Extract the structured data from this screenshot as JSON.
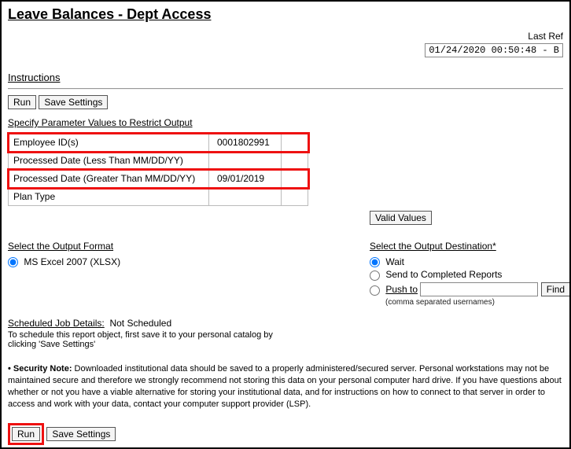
{
  "title": "Leave Balances - Dept Access",
  "lastRefLabel": "Last Ref",
  "refreshStamp": "01/24/2020 00:50:48 - B",
  "instructions": "Instructions",
  "buttons": {
    "run": "Run",
    "saveSettings": "Save Settings",
    "validValues": "Valid Values",
    "find": "Find"
  },
  "paramHeader": "Specify Parameter Values to Restrict Output",
  "params": {
    "employeeId": {
      "label": "Employee ID(s)",
      "value": "0001802991"
    },
    "processedLess": {
      "label": "Processed Date (Less Than MM/DD/YY)",
      "value": ""
    },
    "processedGreater": {
      "label": "Processed Date (Greater Than MM/DD/YY)",
      "value": "09/01/2019"
    },
    "planType": {
      "label": "Plan Type",
      "value": ""
    }
  },
  "outputFormat": {
    "header": "Select the Output Format",
    "option": "MS Excel 2007 (XLSX)"
  },
  "outputDest": {
    "header": "Select the Output Destination*",
    "wait": "Wait",
    "completed": "Send to Completed Reports",
    "pushto": "Push to",
    "note": "(comma separated usernames)"
  },
  "schedule": {
    "header": "Scheduled Job Details:",
    "status": "Not Scheduled",
    "desc": "To schedule this report object, first save it to your personal catalog by clicking 'Save Settings'"
  },
  "securityNote": {
    "label": "Security Note:",
    "text": " Downloaded institutional data should be saved to a properly administered/secured server. Personal workstations may not be maintained secure and therefore we strongly recommend not storing this data on your personal computer hard drive. If you have questions about whether or not you have a viable alternative for storing your institutional data, and for instructions on how to connect to that server in order to access and work with your data, contact your computer support provider (LSP)."
  }
}
